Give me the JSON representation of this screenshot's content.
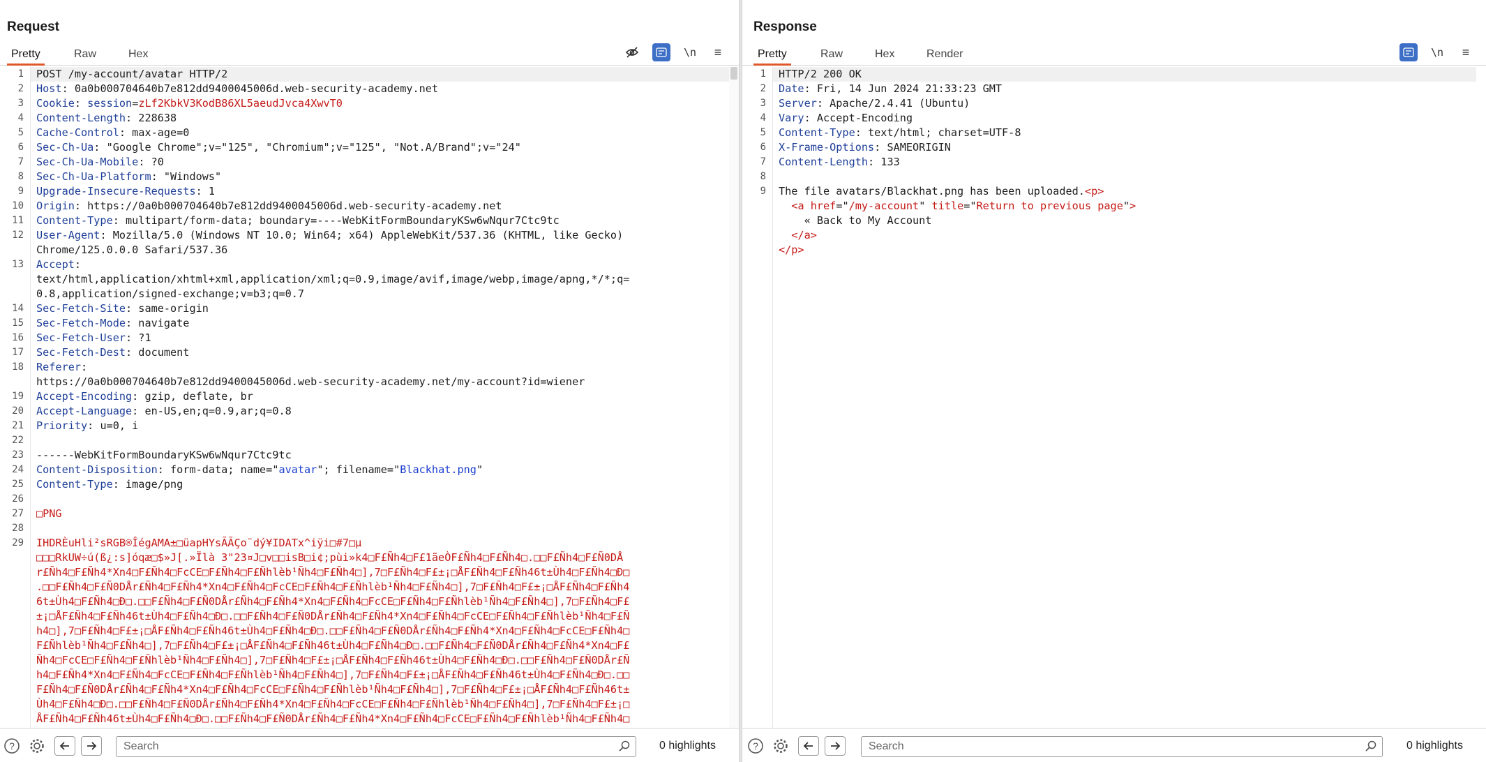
{
  "request": {
    "title": "Request",
    "tabs": [
      {
        "label": "Pretty"
      },
      {
        "label": "Raw"
      },
      {
        "label": "Hex"
      }
    ],
    "tools": {
      "hide_icon": "eye-slash",
      "wrap_icon": "word-wrap",
      "newline": "\\n",
      "menu_icon": "hamburger"
    },
    "lines": [
      {
        "n": "1",
        "html": "POST /my-account/avatar HTTP/2"
      },
      {
        "n": "2",
        "html": "<span class='k'>Host</span>: 0a0b000704640b7e812dd9400045006d.web-security-academy.net"
      },
      {
        "n": "3",
        "html": "<span class='k'>Cookie</span>: <span class='k'>session</span>=<span class='r'>zLf2KbkV3KodB86XL5aeudJvca4XwvT0</span>"
      },
      {
        "n": "4",
        "html": "<span class='k'>Content-Length</span>: 228638"
      },
      {
        "n": "5",
        "html": "<span class='k'>Cache-Control</span>: max-age=0"
      },
      {
        "n": "6",
        "html": "<span class='k'>Sec-Ch-Ua</span>: \"Google Chrome\";v=\"125\", \"Chromium\";v=\"125\", \"Not.A/Brand\";v=\"24\""
      },
      {
        "n": "7",
        "html": "<span class='k'>Sec-Ch-Ua-Mobile</span>: ?0"
      },
      {
        "n": "8",
        "html": "<span class='k'>Sec-Ch-Ua-Platform</span>: \"Windows\""
      },
      {
        "n": "9",
        "html": "<span class='k'>Upgrade-Insecure-Requests</span>: 1"
      },
      {
        "n": "10",
        "html": "<span class='k'>Origin</span>: https://0a0b000704640b7e812dd9400045006d.web-security-academy.net"
      },
      {
        "n": "11",
        "html": "<span class='k'>Content-Type</span>: multipart/form-data; boundary=----WebKitFormBoundaryKSw6wNqur7Ctc9tc"
      },
      {
        "n": "12",
        "html": "<span class='k'>User-Agent</span>: Mozilla/5.0 (Windows NT 10.0; Win64; x64) AppleWebKit/537.36 (KHTML, like Gecko)"
      },
      {
        "n": "",
        "html": "Chrome/125.0.0.0 Safari/537.36"
      },
      {
        "n": "13",
        "html": "<span class='k'>Accept</span>:"
      },
      {
        "n": "",
        "html": "text/html,application/xhtml+xml,application/xml;q=0.9,image/avif,image/webp,image/apng,*/*;q="
      },
      {
        "n": "",
        "html": "0.8,application/signed-exchange;v=b3;q=0.7"
      },
      {
        "n": "14",
        "html": "<span class='k'>Sec-Fetch-Site</span>: same-origin"
      },
      {
        "n": "15",
        "html": "<span class='k'>Sec-Fetch-Mode</span>: navigate"
      },
      {
        "n": "16",
        "html": "<span class='k'>Sec-Fetch-User</span>: ?1"
      },
      {
        "n": "17",
        "html": "<span class='k'>Sec-Fetch-Dest</span>: document"
      },
      {
        "n": "18",
        "html": "<span class='k'>Referer</span>:"
      },
      {
        "n": "",
        "html": "https://0a0b000704640b7e812dd9400045006d.web-security-academy.net/my-account?id=wiener"
      },
      {
        "n": "19",
        "html": "<span class='k'>Accept-Encoding</span>: gzip, deflate, br"
      },
      {
        "n": "20",
        "html": "<span class='k'>Accept-Language</span>: en-US,en;q=0.9,ar;q=0.8"
      },
      {
        "n": "21",
        "html": "<span class='k'>Priority</span>: u=0, i"
      },
      {
        "n": "22",
        "html": ""
      },
      {
        "n": "23",
        "html": "------WebKitFormBoundaryKSw6wNqur7Ctc9tc"
      },
      {
        "n": "24",
        "html": "<span class='k'>Content-Disposition</span>: form-data; name=\"<span class='b'>avatar</span>\"; filename=\"<span class='b'>Blackhat.png</span>\""
      },
      {
        "n": "25",
        "html": "<span class='k'>Content-Type</span>: image/png"
      },
      {
        "n": "26",
        "html": ""
      },
      {
        "n": "27",
        "html": "<span class='bin'>□PNG</span>"
      },
      {
        "n": "28",
        "html": ""
      },
      {
        "n": "29",
        "html": "<span class='bin'>IHDRÈuHli²sRGB®ÎégAMA±□üapHYsÃÃÇo¨dý¥IDATx^iÿi□#7□µ</span>"
      },
      {
        "n": "",
        "html": "<span class='bin'>□□□RkUW÷ú(ß¿:s]óqæ□$»J[.»Ïlà 3\"23¤J□v□□isB□i¢;pùi»k4□F£Ñh4□F£1ãeÒF£Ñh4□F£Ñh4□.□□F£Ñh4□F£Ñ0DÅ</span>"
      },
      {
        "n": "",
        "html": "<span class='bin'>r£Ñh4□F£Ñh4*Xn4□F£Ñh4□FcCE□F£Ñh4□F£Ñhlèb¹Ñh4□F£Ñh4□],7□F£Ñh4□F£±¡□ÅF£Ñh4□F£Ñh46t±Ùh4□F£Ñh4□Ð□</span>"
      },
      {
        "n": "",
        "html": "<span class='bin'>.□□F£Ñh4□F£Ñ0DÅr£Ñh4□F£Ñh4*Xn4□F£Ñh4□FcCE□F£Ñh4□F£Ñhlèb¹Ñh4□F£Ñh4□],7□F£Ñh4□F£±¡□ÅF£Ñh4□F£Ñh4</span>"
      },
      {
        "n": "",
        "html": "<span class='bin'>6t±Ùh4□F£Ñh4□Ð□.□□F£Ñh4□F£Ñ0DÅr£Ñh4□F£Ñh4*Xn4□F£Ñh4□FcCE□F£Ñh4□F£Ñhlèb¹Ñh4□F£Ñh4□],7□F£Ñh4□F£</span>"
      },
      {
        "n": "",
        "html": "<span class='bin'>±¡□ÅF£Ñh4□F£Ñh46t±Ùh4□F£Ñh4□Ð□.□□F£Ñh4□F£Ñ0DÅr£Ñh4□F£Ñh4*Xn4□F£Ñh4□FcCE□F£Ñh4□F£Ñhlèb¹Ñh4□F£Ñ</span>"
      },
      {
        "n": "",
        "html": "<span class='bin'>h4□],7□F£Ñh4□F£±¡□ÅF£Ñh4□F£Ñh46t±Ùh4□F£Ñh4□Ð□.□□F£Ñh4□F£Ñ0DÅr£Ñh4□F£Ñh4*Xn4□F£Ñh4□FcCE□F£Ñh4□</span>"
      },
      {
        "n": "",
        "html": "<span class='bin'>F£Ñhlèb¹Ñh4□F£Ñh4□],7□F£Ñh4□F£±¡□ÅF£Ñh4□F£Ñh46t±Ùh4□F£Ñh4□Ð□.□□F£Ñh4□F£Ñ0DÅr£Ñh4□F£Ñh4*Xn4□F£</span>"
      },
      {
        "n": "",
        "html": "<span class='bin'>Ñh4□FcCE□F£Ñh4□F£Ñhlèb¹Ñh4□F£Ñh4□],7□F£Ñh4□F£±¡□ÅF£Ñh4□F£Ñh46t±Ùh4□F£Ñh4□Ð□.□□F£Ñh4□F£Ñ0DÅr£Ñ</span>"
      },
      {
        "n": "",
        "html": "<span class='bin'>h4□F£Ñh4*Xn4□F£Ñh4□FcCE□F£Ñh4□F£Ñhlèb¹Ñh4□F£Ñh4□],7□F£Ñh4□F£±¡□ÅF£Ñh4□F£Ñh46t±Ùh4□F£Ñh4□Ð□.□□</span>"
      },
      {
        "n": "",
        "html": "<span class='bin'>F£Ñh4□F£Ñ0DÅr£Ñh4□F£Ñh4*Xn4□F£Ñh4□FcCE□F£Ñh4□F£Ñhlèb¹Ñh4□F£Ñh4□],7□F£Ñh4□F£±¡□ÅF£Ñh4□F£Ñh46t±</span>"
      },
      {
        "n": "",
        "html": "<span class='bin'>Ùh4□F£Ñh4□Ð□.□□F£Ñh4□F£Ñ0DÅr£Ñh4□F£Ñh4*Xn4□F£Ñh4□FcCE□F£Ñh4□F£Ñhlèb¹Ñh4□F£Ñh4□],7□F£Ñh4□F£±¡□</span>"
      },
      {
        "n": "",
        "html": "<span class='bin'>ÅF£Ñh4□F£Ñh46t±Ùh4□F£Ñh4□Ð□.□□F£Ñh4□F£Ñ0DÅr£Ñh4□F£Ñh4*Xn4□F£Ñh4□FcCE□F£Ñh4□F£Ñhlèb¹Ñh4□F£Ñh4□</span>"
      }
    ],
    "search_placeholder": "Search",
    "highlights": "0 highlights"
  },
  "response": {
    "title": "Response",
    "tabs": [
      {
        "label": "Pretty"
      },
      {
        "label": "Raw"
      },
      {
        "label": "Hex"
      },
      {
        "label": "Render"
      }
    ],
    "tools": {
      "wrap_icon": "word-wrap",
      "newline": "\\n",
      "menu_icon": "hamburger"
    },
    "lines": [
      {
        "n": "1",
        "html": "HTTP/2 200 OK"
      },
      {
        "n": "2",
        "html": "<span class='k'>Date</span>: Fri, 14 Jun 2024 21:33:23 GMT"
      },
      {
        "n": "3",
        "html": "<span class='k'>Server</span>: Apache/2.4.41 (Ubuntu)"
      },
      {
        "n": "4",
        "html": "<span class='k'>Vary</span>: Accept-Encoding"
      },
      {
        "n": "5",
        "html": "<span class='k'>Content-Type</span>: text/html; charset=UTF-8"
      },
      {
        "n": "6",
        "html": "<span class='k'>X-Frame-Options</span>: SAMEORIGIN"
      },
      {
        "n": "7",
        "html": "<span class='k'>Content-Length</span>: 133"
      },
      {
        "n": "8",
        "html": ""
      },
      {
        "n": "9",
        "html": "The file avatars/Blackhat.png has been uploaded.<span class='r'>&lt;</span><span class='r'>p</span><span class='r'>&gt;</span>"
      },
      {
        "n": "",
        "html": "  <span class='r'>&lt;a</span> <span class='r'>href</span>=\"<span class='r'>/my-account</span>\" <span class='r'>title</span>=\"<span class='r'>Return to previous page</span>\"<span class='r'>&gt;</span>"
      },
      {
        "n": "",
        "html": "    « Back to My Account"
      },
      {
        "n": "",
        "html": "  <span class='r'>&lt;/a&gt;</span>"
      },
      {
        "n": "",
        "html": "<span class='r'>&lt;/p&gt;</span>"
      }
    ],
    "search_placeholder": "Search",
    "highlights": "0 highlights"
  },
  "icons": {
    "help": "help-icon",
    "settings": "gear-icon",
    "back": "arrow-left-icon",
    "forward": "arrow-right-icon",
    "search": "magnifier-icon"
  },
  "colors": {
    "accent": "#e0582a",
    "toggle": "#3d6fc6",
    "header_key": "#1f3f99",
    "string_red": "#c41a16"
  }
}
